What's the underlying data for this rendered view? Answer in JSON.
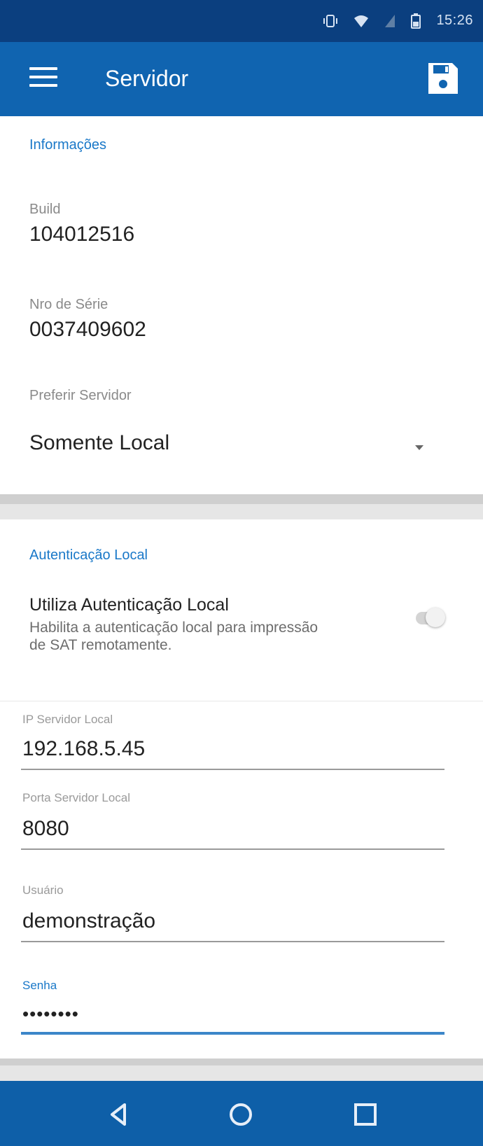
{
  "status_bar": {
    "time": "15:26",
    "icons": [
      "vibrate-icon",
      "wifi-icon",
      "signal-icon",
      "battery-icon"
    ]
  },
  "app_bar": {
    "title": "Servidor",
    "menu_icon": "menu-icon",
    "save_icon": "save-icon",
    "background": "#1064b0"
  },
  "info": {
    "section_title": "Informações",
    "build_label": "Build",
    "build_value": "104012516",
    "serial_label": "Nro de Série",
    "serial_value": "0037409602",
    "pref_label": "Preferir Servidor",
    "pref_value": "Somente Local"
  },
  "auth": {
    "section_title": "Autenticação Local",
    "switch_title": "Utiliza Autenticação Local",
    "switch_desc": "Habilita a autenticação local para impressão de SAT remotamente.",
    "switch_on": false,
    "ip_label": "IP Servidor Local",
    "ip_value": "192.168.5.45",
    "port_label": "Porta Servidor Local",
    "port_value": "8080",
    "user_label": "Usuário",
    "user_value": "demonstração",
    "password_label": "Senha",
    "password_value": "••••••••"
  },
  "nav_bar": {
    "icons": [
      "back-icon",
      "home-icon",
      "recents-icon"
    ]
  },
  "colors": {
    "status_bar": "#0b3f7f",
    "accent": "#1a78c8",
    "nav_bar": "#0e5fa8"
  }
}
